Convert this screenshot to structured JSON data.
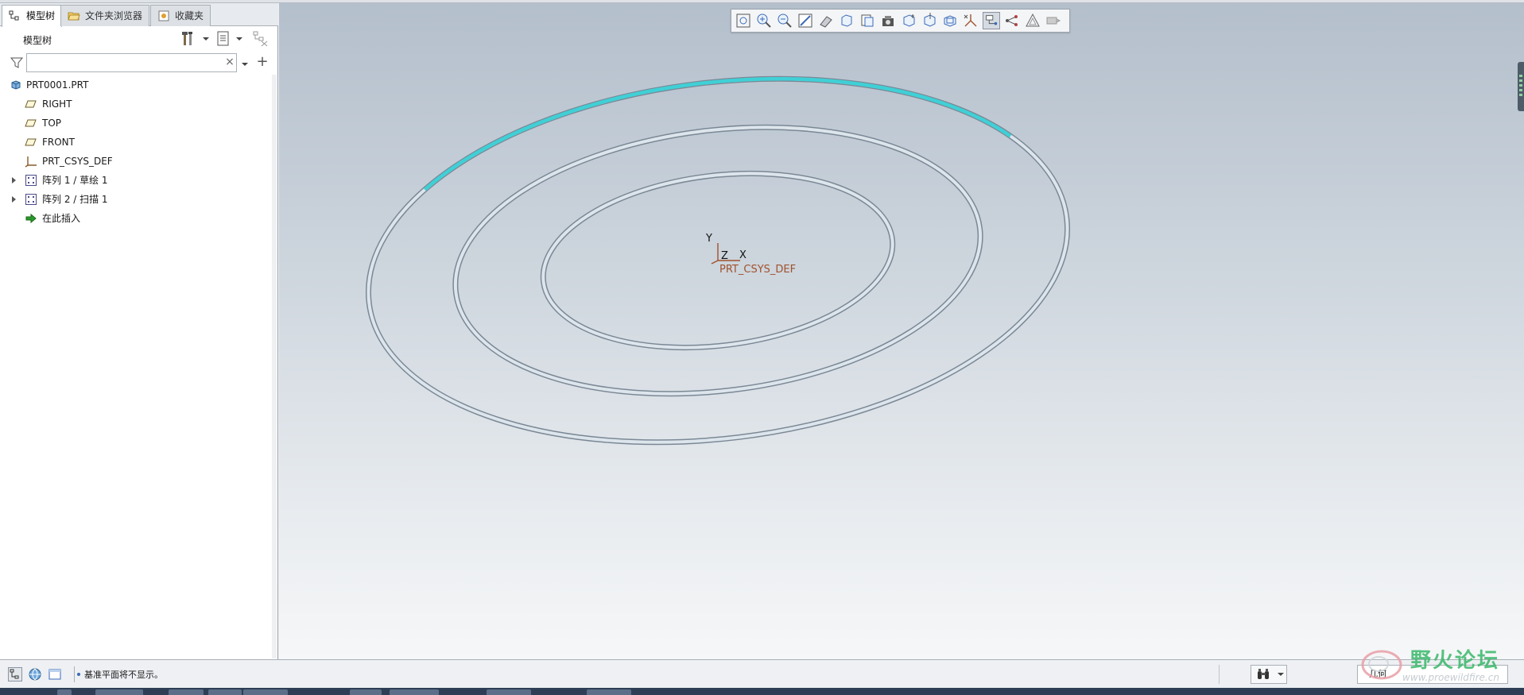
{
  "tabs": [
    {
      "label": "模型树",
      "active": true
    },
    {
      "label": "文件夹浏览器",
      "active": false
    },
    {
      "label": "收藏夹",
      "active": false
    }
  ],
  "tree_header": {
    "title": "模型树"
  },
  "search": {
    "value": "",
    "placeholder": ""
  },
  "tree": {
    "root": "PRT0001.PRT",
    "items": [
      {
        "label": "RIGHT",
        "icon": "datum-plane-icon"
      },
      {
        "label": "TOP",
        "icon": "datum-plane-icon"
      },
      {
        "label": "FRONT",
        "icon": "datum-plane-icon"
      },
      {
        "label": "PRT_CSYS_DEF",
        "icon": "csys-icon"
      },
      {
        "label": "阵列 1 / 草绘 1",
        "icon": "pattern-icon",
        "expandable": true
      },
      {
        "label": "阵列 2 / 扫描 1",
        "icon": "pattern-icon",
        "expandable": true
      },
      {
        "label": "在此插入",
        "icon": "insert-arrow-icon"
      }
    ]
  },
  "viewport": {
    "csys": {
      "y": "Y",
      "z": "Z",
      "x": "X",
      "name": "PRT_CSYS_DEF"
    }
  },
  "view_toolbar": [
    "refit-icon",
    "zoom-in-icon",
    "zoom-out-icon",
    "repaint-icon",
    "spin-center-icon",
    "display-style-icon",
    "saved-orientations-icon",
    "view-manager-icon",
    "datum-planes-icon",
    "datum-axes-icon",
    "point-display-icon",
    "csys-display-icon",
    "annotation-display-icon",
    "spin-icon",
    "perspective-icon",
    "hidden-icon"
  ],
  "status": {
    "message": "基准平面将不显示。"
  },
  "filter_select": {
    "value": "几何"
  },
  "watermark": {
    "title": "野火论坛",
    "url": "www.proewildfire.cn"
  },
  "colors": {
    "ring": "#c8d3dc",
    "ring_edge": "#7a8895",
    "highlight": "#3fd0d6",
    "csys": "#a0522d"
  }
}
